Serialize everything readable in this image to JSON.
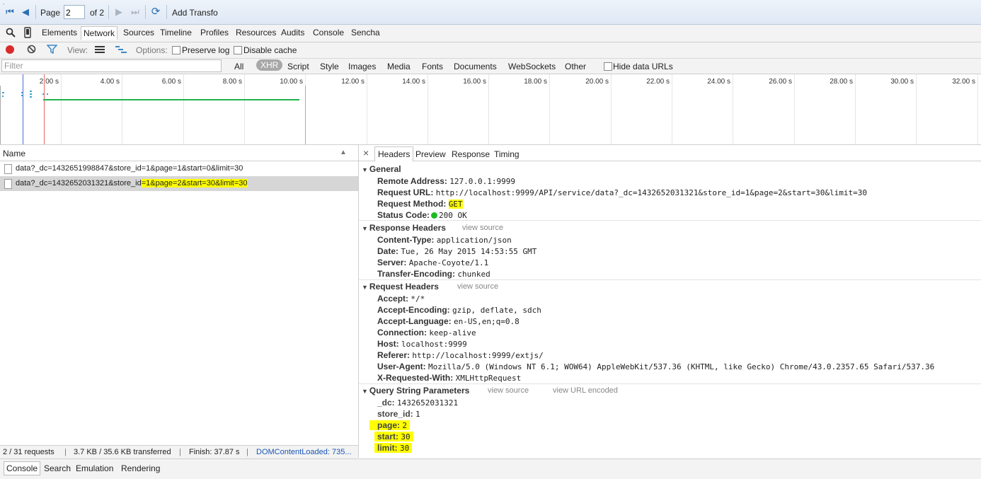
{
  "pager": {
    "page_label": "Page",
    "page_value": "2",
    "of_label": "of 2",
    "add_transfo": "Add Transfo",
    "first_icon": "first-page-icon",
    "prev_icon": "prev-page-icon",
    "next_icon": "next-page-icon",
    "last_icon": "last-page-icon",
    "refresh_icon": "refresh-icon"
  },
  "devtools_tabs": [
    "Elements",
    "Network",
    "Sources",
    "Timeline",
    "Profiles",
    "Resources",
    "Audits",
    "Console",
    "Sencha"
  ],
  "active_devtools_tab": "Network",
  "network_toolbar": {
    "view_label": "View:",
    "options_label": "Options:",
    "preserve_log": "Preserve log",
    "disable_cache": "Disable cache"
  },
  "filter": {
    "placeholder": "Filter",
    "types": [
      "All",
      "XHR",
      "Script",
      "Style",
      "Images",
      "Media",
      "Fonts",
      "Documents",
      "WebSockets",
      "Other"
    ],
    "active_type": "XHR",
    "hide_data_urls": "Hide data URLs"
  },
  "timeline_ticks": [
    "2.00 s",
    "4.00 s",
    "6.00 s",
    "8.00 s",
    "10.00 s",
    "12.00 s",
    "14.00 s",
    "16.00 s",
    "18.00 s",
    "20.00 s",
    "22.00 s",
    "24.00 s",
    "26.00 s",
    "28.00 s",
    "30.00 s",
    "32.00 s"
  ],
  "requests": {
    "header": "Name",
    "rows": [
      {
        "text": "data?_dc=1432651998847&store_id=1&page=1&start=0&limit=30",
        "selected": false
      },
      {
        "text_plain": "data?_dc=1432652031321&store_id",
        "text_hl": "=1&page=2&start=30&limit=30",
        "selected": true
      }
    ]
  },
  "status_bar": {
    "requests": "2 / 31 requests",
    "transferred": "3.7 KB / 35.6 KB transferred",
    "finish": "Finish: 37.87 s",
    "dom_loaded": "DOMContentLoaded: 735..."
  },
  "detail_tabs": [
    "Headers",
    "Preview",
    "Response",
    "Timing"
  ],
  "active_detail_tab": "Headers",
  "general": {
    "title": "General",
    "remote_address_k": "Remote Address:",
    "remote_address_v": "127.0.0.1:9999",
    "request_url_k": "Request URL:",
    "request_url_v": "http://localhost:9999/API/service/data?_dc=1432652031321&store_id=1&page=2&start=30&limit=30",
    "request_method_k": "Request Method:",
    "request_method_v": "GET",
    "status_code_k": "Status Code:",
    "status_code_v": "200 OK"
  },
  "response_headers": {
    "title": "Response Headers",
    "view_source": "view source",
    "items": [
      {
        "k": "Content-Type:",
        "v": "application/json"
      },
      {
        "k": "Date:",
        "v": "Tue, 26 May 2015 14:53:55 GMT"
      },
      {
        "k": "Server:",
        "v": "Apache-Coyote/1.1"
      },
      {
        "k": "Transfer-Encoding:",
        "v": "chunked"
      }
    ]
  },
  "request_headers": {
    "title": "Request Headers",
    "view_source": "view source",
    "items": [
      {
        "k": "Accept:",
        "v": "*/*"
      },
      {
        "k": "Accept-Encoding:",
        "v": "gzip, deflate, sdch"
      },
      {
        "k": "Accept-Language:",
        "v": "en-US,en;q=0.8"
      },
      {
        "k": "Connection:",
        "v": "keep-alive"
      },
      {
        "k": "Host:",
        "v": "localhost:9999"
      },
      {
        "k": "Referer:",
        "v": "http://localhost:9999/extjs/"
      },
      {
        "k": "User-Agent:",
        "v": "Mozilla/5.0 (Windows NT 6.1; WOW64) AppleWebKit/537.36 (KHTML, like Gecko) Chrome/43.0.2357.65 Safari/537.36"
      },
      {
        "k": "X-Requested-With:",
        "v": "XMLHttpRequest"
      }
    ]
  },
  "query_params": {
    "title": "Query String Parameters",
    "view_source": "view source",
    "view_url_encoded": "view URL encoded",
    "items": [
      {
        "k": "_dc:",
        "v": "1432652031321"
      },
      {
        "k": "store_id:",
        "v": "1"
      },
      {
        "k": "page:",
        "v": "2"
      },
      {
        "k": "start:",
        "v": "30"
      },
      {
        "k": "limit:",
        "v": "30"
      }
    ]
  },
  "drawer_tabs": [
    "Console",
    "Search",
    "Emulation",
    "Rendering"
  ],
  "colors": {
    "highlight": "#ffff00",
    "status_ok": "#1fba22",
    "link_blue": "#1a55b4",
    "record_red": "#d92b2b"
  }
}
